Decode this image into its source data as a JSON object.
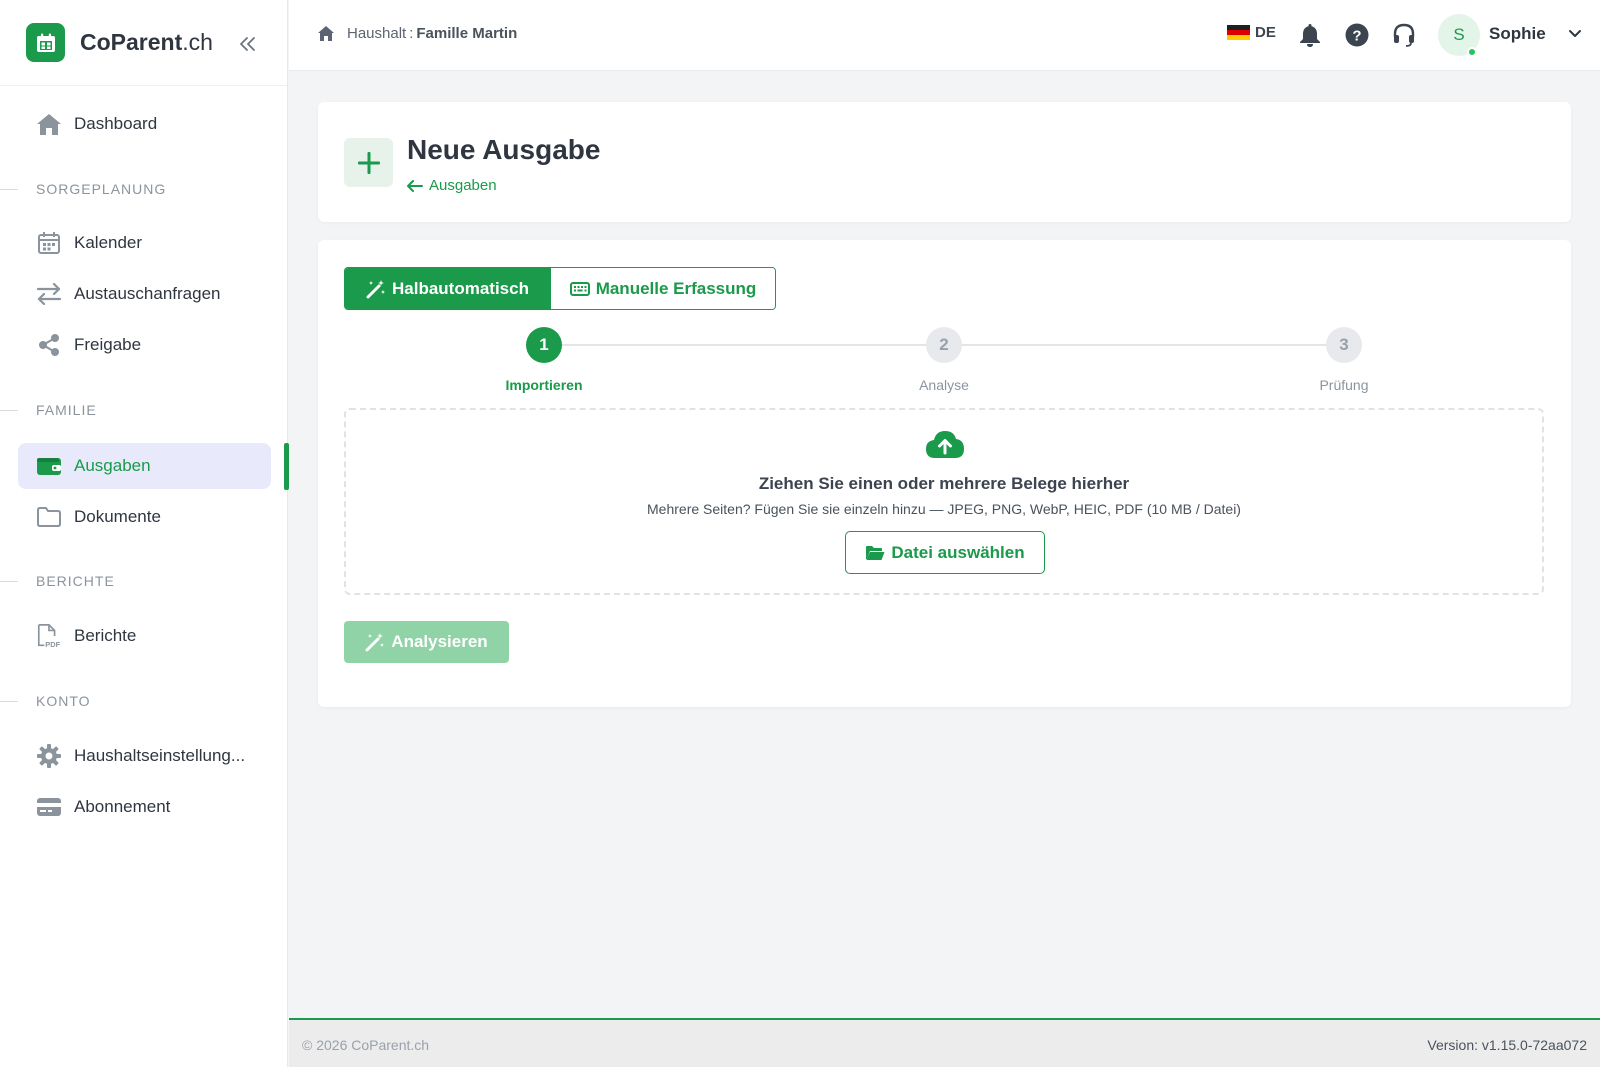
{
  "brand": {
    "name": "CoParent",
    "tld": ".ch"
  },
  "sidebar": {
    "dashboard": "Dashboard",
    "sections": {
      "care": "SORGEPLANUNG",
      "family": "FAMILIE",
      "reports": "BERICHTE",
      "account": "KONTO"
    },
    "items": {
      "calendar": "Kalender",
      "exchange": "Austauschanfragen",
      "share": "Freigabe",
      "expenses": "Ausgaben",
      "documents": "Dokumente",
      "reports": "Berichte",
      "household_settings": "Haushaltseinstellung...",
      "subscription": "Abonnement"
    },
    "active_item": "Ausgaben"
  },
  "header": {
    "breadcrumb": {
      "label": "Haushalt",
      "separator": ":",
      "household": "Famille Martin"
    },
    "language": "DE",
    "user": {
      "initial": "S",
      "name": "Sophie",
      "online": true
    }
  },
  "page": {
    "title": "Neue Ausgabe",
    "back_link": "Ausgaben"
  },
  "mode_toggle": {
    "semi_auto": "Halbautomatisch",
    "manual": "Manuelle Erfassung",
    "selected": "Halbautomatisch"
  },
  "stepper": {
    "steps": [
      {
        "number": "1",
        "label": "Importieren",
        "state": "current"
      },
      {
        "number": "2",
        "label": "Analyse",
        "state": "todo"
      },
      {
        "number": "3",
        "label": "Prüfung",
        "state": "todo"
      }
    ]
  },
  "dropzone": {
    "title": "Ziehen Sie einen oder mehrere Belege hierher",
    "hint": "Mehrere Seiten? Fügen Sie sie einzeln hinzu — JPEG, PNG, WebP, HEIC, PDF (10 MB / Datei)",
    "button": "Datei auswählen"
  },
  "analyze_button": {
    "label": "Analysieren",
    "disabled": true
  },
  "footer": {
    "copyright": "© 2026 CoParent.ch",
    "version": "Version: v1.15.0-72aa072"
  },
  "colors": {
    "accent": "#1a9a4a",
    "accent_light": "#8fd3a6",
    "active_nav_bg": "#e8eafc",
    "page_bg": "#f3f4f5",
    "online": "#22c55e"
  },
  "icons": {
    "brand": "calendar-app-icon",
    "collapse": "double-chevron-left-icon",
    "dashboard": "home-icon",
    "calendar": "calendar-icon",
    "exchange": "arrows-exchange-icon",
    "share": "share-icon",
    "expenses": "wallet-icon",
    "documents": "folder-icon",
    "reports": "pdf-file-icon",
    "settings": "gear-icon",
    "subscription": "credit-card-icon",
    "notifications": "bell-icon",
    "help": "question-circle-icon",
    "support": "headset-icon",
    "upload": "cloud-upload-icon",
    "magic": "magic-wand-icon",
    "keyboard": "keyboard-icon",
    "open_folder": "folder-open-icon"
  }
}
